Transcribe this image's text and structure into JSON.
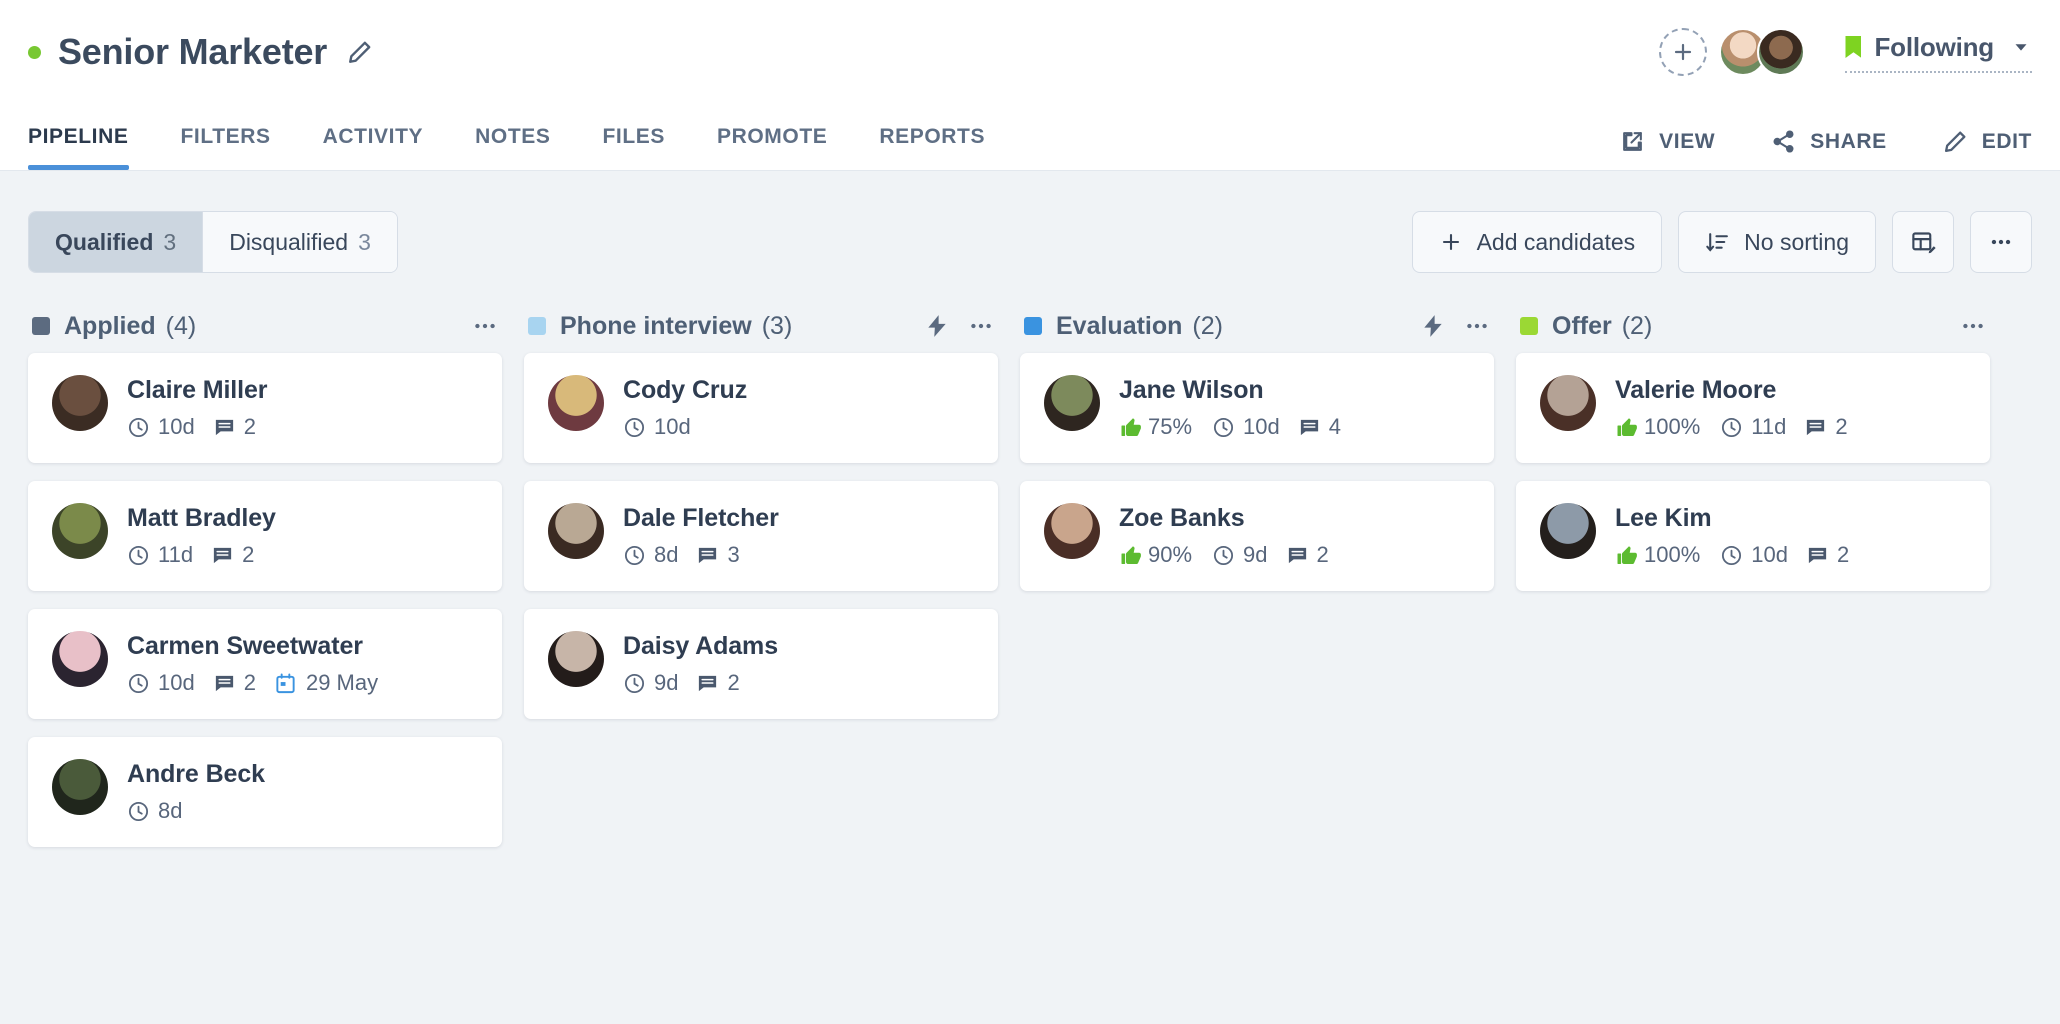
{
  "header": {
    "status_color": "#78c832",
    "job_title": "Senior Marketer",
    "edit_title_icon": "pencil-icon",
    "add_follower_icon": "plus-icon",
    "following_label": "Following",
    "following_icon": "bookmark-icon",
    "following_color": "#7ed321",
    "chevron_icon": "chevron-down-icon"
  },
  "tabs": [
    {
      "label": "PIPELINE",
      "active": true
    },
    {
      "label": "FILTERS",
      "active": false
    },
    {
      "label": "ACTIVITY",
      "active": false
    },
    {
      "label": "NOTES",
      "active": false
    },
    {
      "label": "FILES",
      "active": false
    },
    {
      "label": "PROMOTE",
      "active": false
    },
    {
      "label": "REPORTS",
      "active": false
    }
  ],
  "header_actions": [
    {
      "label": "VIEW",
      "icon": "external-link-icon"
    },
    {
      "label": "SHARE",
      "icon": "share-icon"
    },
    {
      "label": "EDIT",
      "icon": "pencil-icon"
    }
  ],
  "toolbar": {
    "segments": [
      {
        "label": "Qualified",
        "count": "3",
        "active": true
      },
      {
        "label": "Disqualified",
        "count": "3",
        "active": false
      }
    ],
    "add_candidates_label": "Add candidates",
    "add_candidates_icon": "plus-icon",
    "sorting_label": "No sorting",
    "sorting_icon": "sort-descending-icon",
    "table_edit_icon": "table-edit-icon",
    "more_icon": "ellipsis-icon"
  },
  "board": {
    "columns": [
      {
        "name": "Applied",
        "count": "(4)",
        "color": "#5c6b80",
        "has_bolt": false,
        "cards": [
          {
            "name": "Claire Miller",
            "days": "10d",
            "comments": "2",
            "rating": null,
            "date": null,
            "avatar_a": "#6a4f3f",
            "avatar_b": "#3b2c23"
          },
          {
            "name": "Matt Bradley",
            "days": "11d",
            "comments": "2",
            "rating": null,
            "date": null,
            "avatar_a": "#7b8a4a",
            "avatar_b": "#3c4428"
          },
          {
            "name": "Carmen Sweetwater",
            "days": "10d",
            "comments": "2",
            "rating": null,
            "date": "29 May",
            "avatar_a": "#e8c0c8",
            "avatar_b": "#2b2430"
          },
          {
            "name": "Andre Beck",
            "days": "8d",
            "comments": null,
            "rating": null,
            "date": null,
            "avatar_a": "#4a5a3a",
            "avatar_b": "#20261c"
          }
        ]
      },
      {
        "name": "Phone interview",
        "count": "(3)",
        "color": "#a8d4f0",
        "has_bolt": true,
        "cards": [
          {
            "name": "Cody Cruz",
            "days": "10d",
            "comments": null,
            "rating": null,
            "date": null,
            "avatar_a": "#d8b97a",
            "avatar_b": "#6e3a40"
          },
          {
            "name": "Dale Fletcher",
            "days": "8d",
            "comments": "3",
            "rating": null,
            "date": null,
            "avatar_a": "#b9a894",
            "avatar_b": "#3a2a22"
          },
          {
            "name": "Daisy Adams",
            "days": "9d",
            "comments": "2",
            "rating": null,
            "date": null,
            "avatar_a": "#c7b5a8",
            "avatar_b": "#231c1a"
          }
        ]
      },
      {
        "name": "Evaluation",
        "count": "(2)",
        "color": "#3a93e0",
        "has_bolt": true,
        "cards": [
          {
            "name": "Jane Wilson",
            "days": "10d",
            "comments": "4",
            "rating": "75%",
            "date": null,
            "avatar_a": "#7d8a5c",
            "avatar_b": "#2e2620"
          },
          {
            "name": "Zoe Banks",
            "days": "9d",
            "comments": "2",
            "rating": "90%",
            "date": null,
            "avatar_a": "#c9a58c",
            "avatar_b": "#4a2e26"
          }
        ]
      },
      {
        "name": "Offer",
        "count": "(2)",
        "color": "#9bd834",
        "has_bolt": false,
        "cards": [
          {
            "name": "Valerie Moore",
            "days": "11d",
            "comments": "2",
            "rating": "100%",
            "date": null,
            "avatar_a": "#b4a295",
            "avatar_b": "#4a3027"
          },
          {
            "name": "Lee Kim",
            "days": "10d",
            "comments": "2",
            "rating": "100%",
            "date": null,
            "avatar_a": "#8d9aa8",
            "avatar_b": "#241f1c"
          }
        ]
      }
    ],
    "icons": {
      "clock": "clock-icon",
      "comment": "comment-icon",
      "calendar": "calendar-icon",
      "thumbs_up": "thumbs-up-icon",
      "bolt": "lightning-bolt-icon",
      "ellipsis": "ellipsis-icon"
    },
    "rating_color": "#5cbb30",
    "calendar_color": "#3a93e0"
  }
}
